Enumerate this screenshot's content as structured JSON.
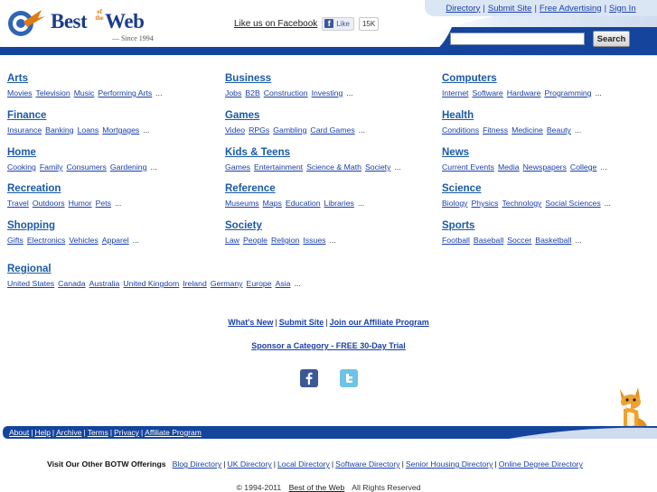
{
  "header": {
    "logo_text": "Best",
    "logo_ofthe": "of the",
    "logo_web": "Web",
    "logo_since": "— Since 1994",
    "facebook_text": "Like us on Facebook",
    "facebook_like": "Like",
    "facebook_count": "15K",
    "topnav": [
      "Directory",
      "Submit Site",
      "Free Advertising",
      "Sign In"
    ],
    "search_placeholder": "",
    "search_button": "Search"
  },
  "colors": {
    "brand_blue": "#1c3d8c",
    "bar_blue": "#14449c",
    "link_blue": "#1a3fa8",
    "accent_orange": "#e07a12"
  },
  "categories": [
    {
      "title": "Arts",
      "subs": [
        "Movies",
        "Television",
        "Music",
        "Performing Arts"
      ]
    },
    {
      "title": "Business",
      "subs": [
        "Jobs",
        "B2B",
        "Construction",
        "Investing"
      ]
    },
    {
      "title": "Computers",
      "subs": [
        "Internet",
        "Software",
        "Hardware",
        "Programming"
      ]
    },
    {
      "title": "Finance",
      "subs": [
        "Insurance",
        "Banking",
        "Loans",
        "Mortgages"
      ]
    },
    {
      "title": "Games",
      "subs": [
        "Video",
        "RPGs",
        "Gambling",
        "Card Games"
      ]
    },
    {
      "title": "Health",
      "subs": [
        "Conditions",
        "Fitness",
        "Medicine",
        "Beauty"
      ]
    },
    {
      "title": "Home",
      "subs": [
        "Cooking",
        "Family",
        "Consumers",
        "Gardening"
      ]
    },
    {
      "title": "Kids & Teens",
      "subs": [
        "Games",
        "Entertainment",
        "Science & Math",
        "Society"
      ]
    },
    {
      "title": "News",
      "subs": [
        "Current Events",
        "Media",
        "Newspapers",
        "College"
      ]
    },
    {
      "title": "Recreation",
      "subs": [
        "Travel",
        "Outdoors",
        "Humor",
        "Pets"
      ]
    },
    {
      "title": "Reference",
      "subs": [
        "Museums",
        "Maps",
        "Education",
        "Libraries"
      ]
    },
    {
      "title": "Science",
      "subs": [
        "Biology",
        "Physics",
        "Technology",
        "Social Sciences"
      ]
    },
    {
      "title": "Shopping",
      "subs": [
        "Gifts",
        "Electronics",
        "Vehicles",
        "Apparel"
      ]
    },
    {
      "title": "Society",
      "subs": [
        "Law",
        "People",
        "Religion",
        "Issues"
      ]
    },
    {
      "title": "Sports",
      "subs": [
        "Football",
        "Baseball",
        "Soccer",
        "Basketball"
      ]
    },
    {
      "title": "Regional",
      "subs": [
        "United States",
        "Canada",
        "Australia",
        "United Kingdom",
        "Ireland",
        "Germany",
        "Europe",
        "Asia"
      ]
    }
  ],
  "more_marker": "...",
  "center_links": [
    "What's New",
    "Submit Site",
    "Join our Affiliate Program"
  ],
  "sponsor_link": "Sponsor a Category - FREE 30-Day Trial",
  "social": [
    "facebook-icon",
    "twitter-icon"
  ],
  "footer_links": [
    "About",
    "Help",
    "Archive",
    "Terms",
    "Privacy",
    "Affiliate Program"
  ],
  "other_offerings": {
    "label": "Visit Our Other BOTW Offerings",
    "links": [
      "Blog Directory",
      "UK Directory",
      "Local Directory",
      "Software Directory",
      "Senior Housing Directory",
      "Online Degree Directory"
    ]
  },
  "copyright": {
    "years": "© 1994-2011",
    "site": "Best of the Web",
    "rights": "All Rights Reserved"
  }
}
